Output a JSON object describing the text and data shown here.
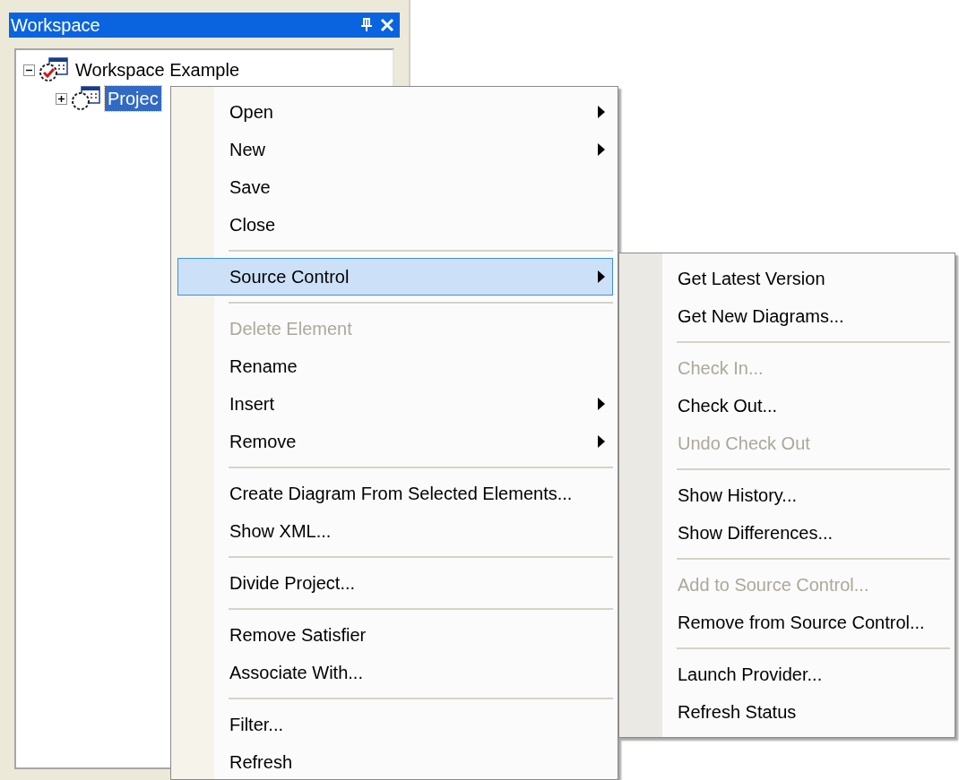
{
  "panel": {
    "title": "Workspace",
    "tree": [
      {
        "label": "Workspace Example",
        "expanded": true,
        "selected": false,
        "children": [
          {
            "label": "Projec",
            "expanded": false,
            "selected": true
          }
        ]
      }
    ]
  },
  "context_menu": {
    "items": [
      {
        "kind": "item",
        "label": "Open",
        "disabled": false,
        "submenu": true,
        "selected": false
      },
      {
        "kind": "item",
        "label": "New",
        "disabled": false,
        "submenu": true,
        "selected": false
      },
      {
        "kind": "item",
        "label": "Save",
        "disabled": false,
        "submenu": false,
        "selected": false
      },
      {
        "kind": "item",
        "label": "Close",
        "disabled": false,
        "submenu": false,
        "selected": false
      },
      {
        "kind": "separator"
      },
      {
        "kind": "item",
        "label": "Source Control",
        "disabled": false,
        "submenu": true,
        "selected": true
      },
      {
        "kind": "separator"
      },
      {
        "kind": "item",
        "label": "Delete Element",
        "disabled": true,
        "submenu": false,
        "selected": false
      },
      {
        "kind": "item",
        "label": "Rename",
        "disabled": false,
        "submenu": false,
        "selected": false
      },
      {
        "kind": "item",
        "label": "Insert",
        "disabled": false,
        "submenu": true,
        "selected": false
      },
      {
        "kind": "item",
        "label": "Remove",
        "disabled": false,
        "submenu": true,
        "selected": false
      },
      {
        "kind": "separator"
      },
      {
        "kind": "item",
        "label": "Create Diagram From Selected Elements...",
        "disabled": false,
        "submenu": false,
        "selected": false
      },
      {
        "kind": "item",
        "label": "Show XML...",
        "disabled": false,
        "submenu": false,
        "selected": false
      },
      {
        "kind": "separator"
      },
      {
        "kind": "item",
        "label": "Divide Project...",
        "disabled": false,
        "submenu": false,
        "selected": false
      },
      {
        "kind": "separator"
      },
      {
        "kind": "item",
        "label": "Remove Satisfier",
        "disabled": false,
        "submenu": false,
        "selected": false
      },
      {
        "kind": "item",
        "label": "Associate With...",
        "disabled": false,
        "submenu": false,
        "selected": false
      },
      {
        "kind": "separator"
      },
      {
        "kind": "item",
        "label": "Filter...",
        "disabled": false,
        "submenu": false,
        "selected": false
      },
      {
        "kind": "item",
        "label": "Refresh",
        "disabled": false,
        "submenu": false,
        "selected": false
      }
    ]
  },
  "submenu": {
    "items": [
      {
        "kind": "item",
        "label": "Get Latest Version",
        "disabled": false,
        "submenu": false,
        "selected": false
      },
      {
        "kind": "item",
        "label": "Get New Diagrams...",
        "disabled": false,
        "submenu": false,
        "selected": false
      },
      {
        "kind": "separator"
      },
      {
        "kind": "item",
        "label": "Check In...",
        "disabled": true,
        "submenu": false,
        "selected": false
      },
      {
        "kind": "item",
        "label": "Check Out...",
        "disabled": false,
        "submenu": false,
        "selected": false
      },
      {
        "kind": "item",
        "label": "Undo Check Out",
        "disabled": true,
        "submenu": false,
        "selected": false
      },
      {
        "kind": "separator"
      },
      {
        "kind": "item",
        "label": "Show History...",
        "disabled": false,
        "submenu": false,
        "selected": false
      },
      {
        "kind": "item",
        "label": "Show Differences...",
        "disabled": false,
        "submenu": false,
        "selected": false
      },
      {
        "kind": "separator"
      },
      {
        "kind": "item",
        "label": "Add to Source Control...",
        "disabled": true,
        "submenu": false,
        "selected": false
      },
      {
        "kind": "item",
        "label": "Remove from Source Control...",
        "disabled": false,
        "submenu": false,
        "selected": false
      },
      {
        "kind": "separator"
      },
      {
        "kind": "item",
        "label": "Launch Provider...",
        "disabled": false,
        "submenu": false,
        "selected": false
      },
      {
        "kind": "item",
        "label": "Refresh Status",
        "disabled": false,
        "submenu": false,
        "selected": false
      }
    ]
  }
}
